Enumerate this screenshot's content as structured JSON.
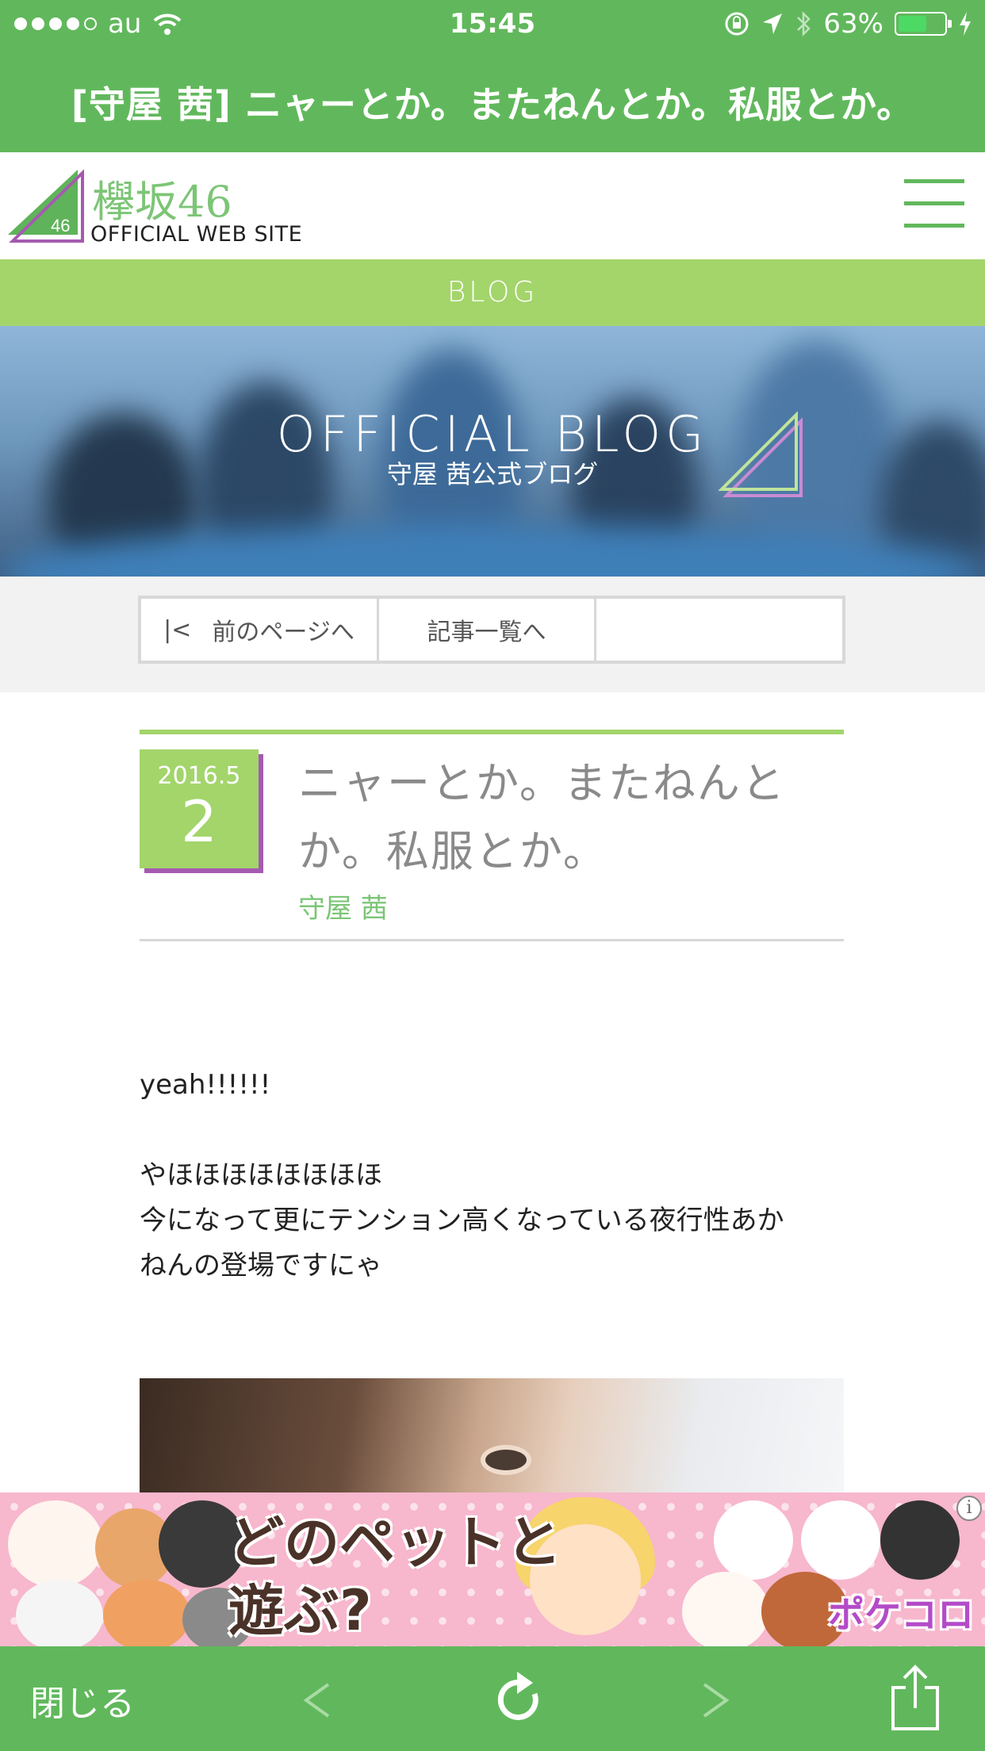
{
  "status_bar": {
    "carrier": "au",
    "time": "15:45",
    "battery_percent": "63%",
    "battery_level": 0.63,
    "icons": [
      "signal-dots-icon",
      "wifi-icon",
      "orientation-lock-icon",
      "location-icon",
      "bluetooth-icon",
      "battery-icon",
      "charging-icon"
    ]
  },
  "title_bar": {
    "title": "[守屋 茜] ニャーとか。またねんとか。私服とか。"
  },
  "site_header": {
    "brand_jp": "欅坂46",
    "brand_en": "OFFICIAL WEB SITE",
    "logo_number": "46",
    "menu_icon": "hamburger-menu-icon"
  },
  "section_bar": {
    "label": "BLOG"
  },
  "hero": {
    "title": "OFFICIAL BLOG",
    "subtitle": "守屋 茜公式ブログ"
  },
  "pager": {
    "prev_symbol": "|<",
    "prev_label": "前のページへ",
    "list_label": "記事一覧へ"
  },
  "entry": {
    "date_year_month": "2016.5",
    "date_day": "2",
    "title": "ニャーとか。またねんとか。私服とか。",
    "author": "守屋 茜",
    "body_lines": [
      "yeah!!!!!!",
      "",
      "やほほほほほほほほ",
      "今になって更にテンション高くなっている夜行性あか",
      "ねんの登場ですにゃ"
    ]
  },
  "ad": {
    "headline_line1": "どのペットと",
    "headline_line2": "遊ぶ?",
    "brand": "ポケコロ",
    "info_symbol": "i"
  },
  "toolbar": {
    "close_label": "閉じる",
    "back_symbol": "<",
    "forward_symbol": ">",
    "icons": [
      "back-arrow-icon",
      "reload-icon",
      "forward-arrow-icon",
      "share-icon"
    ]
  },
  "colors": {
    "header_green": "#61b85c",
    "light_green": "#a3d56b",
    "accent_purple": "#a55ab0",
    "brand_green": "#7cc576"
  }
}
